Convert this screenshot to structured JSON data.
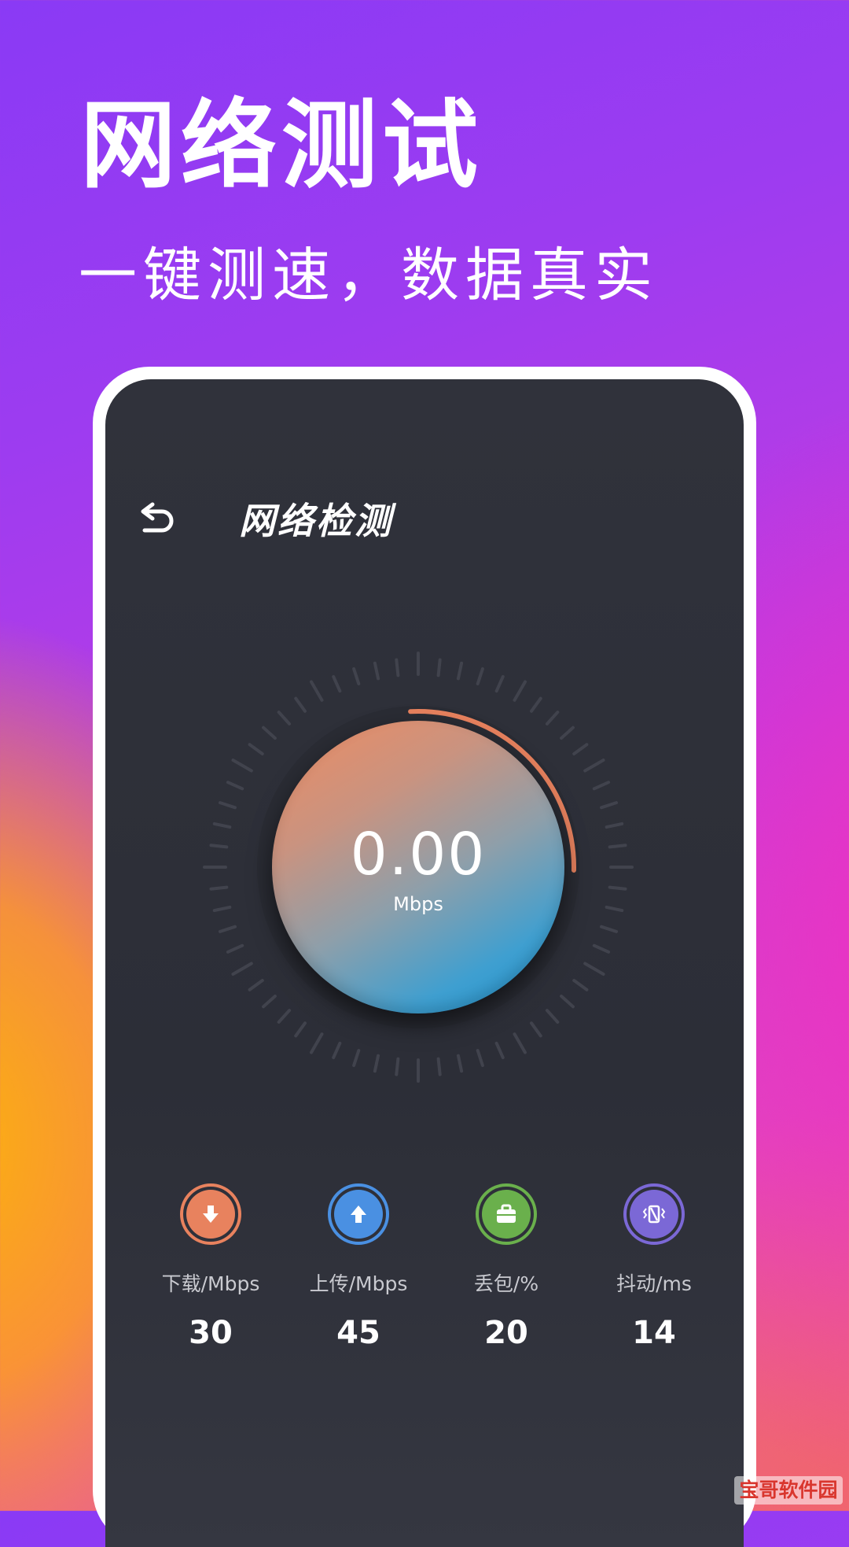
{
  "promo": {
    "headline": "网络测试",
    "subline": "一键测速，数据真实"
  },
  "app": {
    "header": {
      "back_icon": "back-arrow-icon",
      "title": "网络检测"
    },
    "gauge": {
      "value": "0.00",
      "unit": "Mbps"
    },
    "stats": [
      {
        "icon": "download-icon",
        "label": "下载/Mbps",
        "value": "30",
        "color": "#e8825e"
      },
      {
        "icon": "upload-icon",
        "label": "上传/Mbps",
        "value": "45",
        "color": "#4a90e2"
      },
      {
        "icon": "briefcase-icon",
        "label": "丢包/%",
        "value": "20",
        "color": "#6ab04c"
      },
      {
        "icon": "vibrate-icon",
        "label": "抖动/ms",
        "value": "14",
        "color": "#7b68d6"
      }
    ]
  },
  "colors": {
    "screen_bg": "#30323b",
    "progress_arc": "#e8825e"
  },
  "watermark": "宝哥软件园"
}
